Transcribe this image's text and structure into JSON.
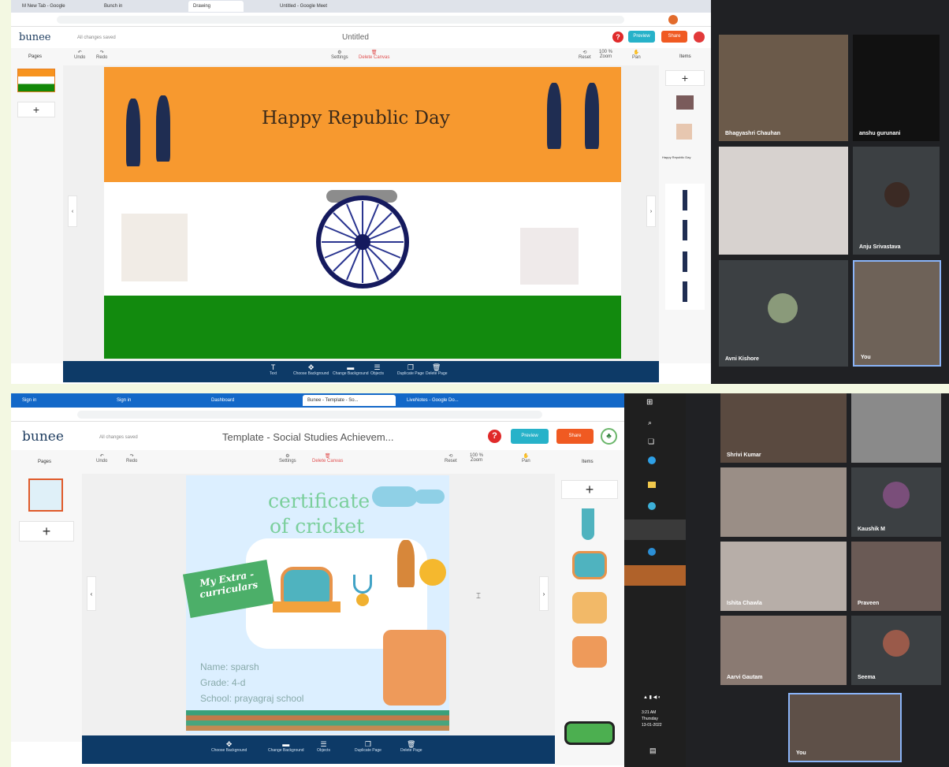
{
  "top": {
    "tabs": [
      "M New Tab - Google",
      "Bunch in",
      "Drawing",
      "Untitled - Google Meet"
    ],
    "app_logo": "bunee",
    "save_status": "All changes saved",
    "doc_title": "Untitled",
    "toolbar": {
      "undo": "Undo",
      "redo": "Redo",
      "settings": "Settings",
      "delete": "Delete Canvas",
      "reset": "Reset",
      "zoom_value": "100 %",
      "zoom": "Zoom",
      "pan": "Pan"
    },
    "pages_label": "Pages",
    "items_label": "Items",
    "items_sublabel": "Happy Republic Day",
    "preview": "Preview",
    "share": "Share",
    "slide_title": "Happy Republic Day",
    "bottom_tools": [
      "Text",
      "Choose Background",
      "Change Background",
      "Objects",
      "Duplicate Page",
      "Delete Page"
    ],
    "participants": [
      "Bhagyashri Chauhan",
      "anshu gurunani",
      "",
      "Anju Srivastava",
      "Avni Kishore",
      "You"
    ]
  },
  "bottom": {
    "tabs": [
      "Sign in",
      "Sign in",
      "Dashboard",
      "Bunee - Template - So...",
      "LiveNotes - Google Do..."
    ],
    "app_logo": "bunee",
    "save_status": "All changes saved",
    "doc_title": "Template - Social Studies Achievem...",
    "toolbar": {
      "undo": "Undo",
      "redo": "Redo",
      "settings": "Settings",
      "delete": "Delete Canvas",
      "reset": "Reset",
      "zoom_value": "100 %",
      "zoom": "Zoom",
      "pan": "Pan"
    },
    "pages_label": "Pages",
    "items_label": "Items",
    "preview": "Preview",
    "share": "Share",
    "cert_title_1": "certificate",
    "cert_title_2": "of cricket",
    "ribbon": "My Extra -curriculars",
    "name_line": "Name: sparsh",
    "grade_line": "Grade: 4-d",
    "school_line": "School: prayagraj school",
    "bottom_tools": [
      "Choose Background",
      "Change Background",
      "Objects",
      "Duplicate Page",
      "Delete Page"
    ],
    "clock_time": "3:21 AM",
    "clock_day": "Thursday",
    "clock_date": "13-01-2022",
    "participants": [
      "Shrivi Kumar",
      "",
      "",
      "Kaushik M",
      "Ishita Chawla",
      "Praveen",
      "Aarvi Gautam",
      "Seema",
      "You"
    ]
  }
}
